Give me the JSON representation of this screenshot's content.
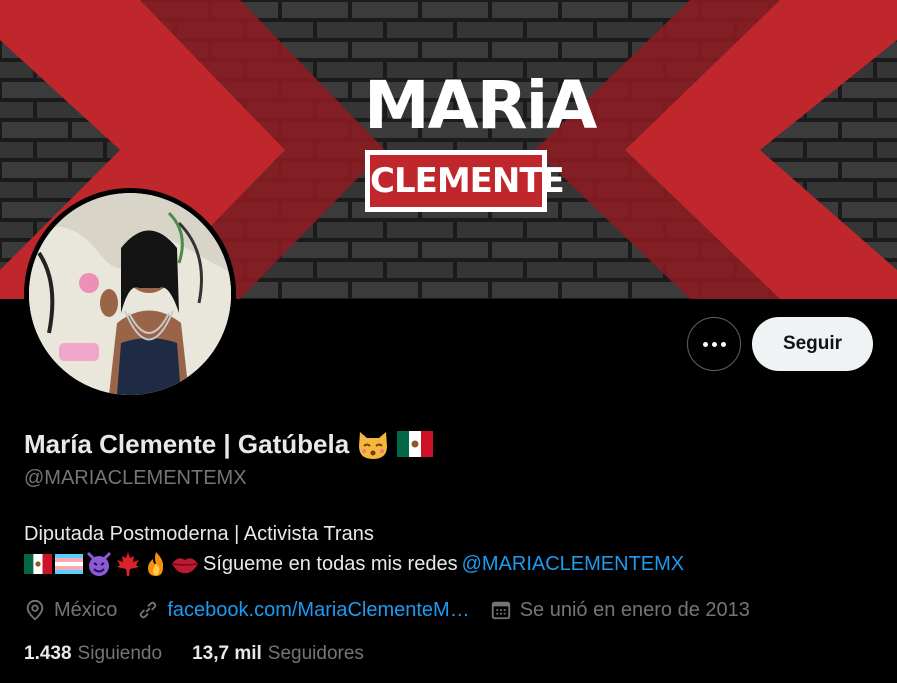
{
  "banner": {
    "logo_top": "MARiA",
    "logo_bottom": "CLEMENTE",
    "colors": {
      "brick": "#2e2e2e",
      "accent": "#c0272d"
    }
  },
  "profile": {
    "display_name": "María Clemente | Gatúbela",
    "name_emojis": [
      "kissing-cat-icon",
      "mexico-flag-icon"
    ],
    "handle": "@MARIACLEMENTEMX"
  },
  "actions": {
    "more_icon": "more-dots-icon",
    "follow_label": "Seguir"
  },
  "bio": {
    "line1": "Diputada Postmoderna | Activista Trans",
    "line2_emojis": [
      "mexico-flag-icon",
      "trans-flag-icon",
      "smiling-devil-icon",
      "maple-leaf-icon",
      "fire-icon",
      "lips-icon"
    ],
    "line2_text": "Sígueme en todas mis redes",
    "mention": "@MARIACLEMENTEMX"
  },
  "meta": {
    "location": "México",
    "website": "facebook.com/MariaClementeM…",
    "joined": "Se unió en enero de 2013"
  },
  "stats": {
    "following_count": "1.438",
    "following_label": "Siguiendo",
    "followers_count": "13,7 mil",
    "followers_label": "Seguidores"
  },
  "colors": {
    "link": "#1d9bf0",
    "muted": "#71767b",
    "text": "#e7e9ea"
  }
}
